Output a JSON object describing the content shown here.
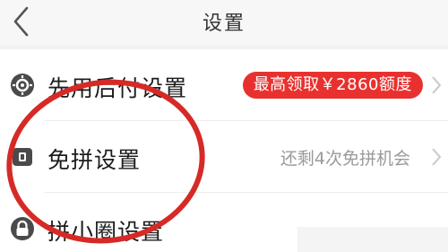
{
  "header": {
    "title": "设置",
    "back_icon": "chevron-left-icon"
  },
  "rows": [
    {
      "label": "先用后付设置",
      "icon": "gear-badge-icon",
      "badge": "最高领取￥2860额度"
    },
    {
      "label": "免拼设置",
      "icon": "wallet-icon",
      "value": "还剩4次免拼机会"
    },
    {
      "label": "拼小圈设置",
      "icon": "lock-icon"
    }
  ],
  "colors": {
    "accent": "#e8312f",
    "annotation_circle": "#d62a26",
    "muted_text": "#9a9a9a",
    "chevron": "#c8c8c8"
  }
}
